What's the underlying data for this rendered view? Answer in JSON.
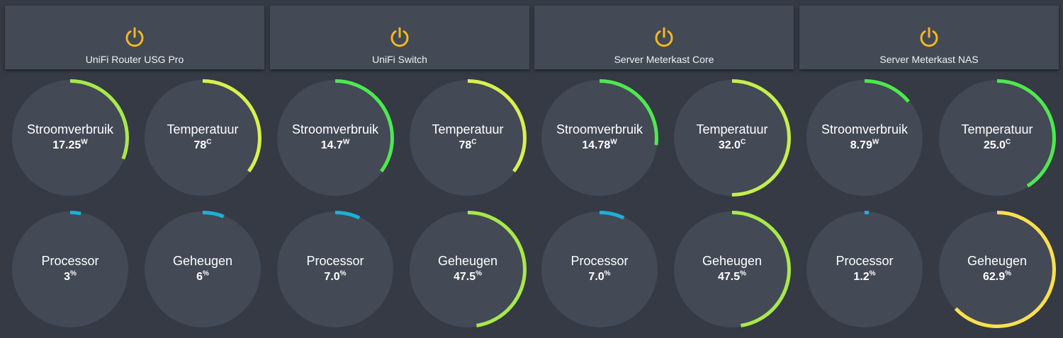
{
  "colors": {
    "background": "#353a44",
    "card": "#434955",
    "gauge_disc": "#434955",
    "power_icon": "#f5b723"
  },
  "devices": [
    {
      "name": "UniFi Router USG Pro",
      "icon": "power-icon",
      "gauges": [
        {
          "label": "Stroomverbruik",
          "value": "17.25",
          "unit": "W",
          "fill": 0.31,
          "color": "#a8e94b"
        },
        {
          "label": "Temperatuur",
          "value": "78",
          "unit": "C",
          "fill": 0.35,
          "color": "#d9f04f"
        },
        {
          "label": "Processor",
          "value": "3",
          "unit": "%",
          "fill": 0.03,
          "color": "#1bb1d6"
        },
        {
          "label": "Geheugen",
          "value": "6",
          "unit": "%",
          "fill": 0.06,
          "color": "#1bb1d6"
        }
      ]
    },
    {
      "name": "UniFi Switch",
      "icon": "power-icon",
      "gauges": [
        {
          "label": "Stroomverbruik",
          "value": "14.7",
          "unit": "W",
          "fill": 0.35,
          "color": "#4de94f"
        },
        {
          "label": "Temperatuur",
          "value": "78",
          "unit": "C",
          "fill": 0.35,
          "color": "#d9f04f"
        },
        {
          "label": "Processor",
          "value": "7.0",
          "unit": "%",
          "fill": 0.07,
          "color": "#1bb1d6"
        },
        {
          "label": "Geheugen",
          "value": "47.5",
          "unit": "%",
          "fill": 0.475,
          "color": "#a8e94b"
        }
      ]
    },
    {
      "name": "Server Meterkast Core",
      "icon": "power-icon",
      "gauges": [
        {
          "label": "Stroomverbruik",
          "value": "14.78",
          "unit": "W",
          "fill": 0.27,
          "color": "#4de94f"
        },
        {
          "label": "Temperatuur",
          "value": "32.0",
          "unit": "C",
          "fill": 0.5,
          "color": "#c4ef4c"
        },
        {
          "label": "Processor",
          "value": "7.0",
          "unit": "%",
          "fill": 0.07,
          "color": "#1bb1d6"
        },
        {
          "label": "Geheugen",
          "value": "47.5",
          "unit": "%",
          "fill": 0.475,
          "color": "#a8e94b"
        }
      ]
    },
    {
      "name": "Server Meterkast NAS",
      "icon": "power-icon",
      "gauges": [
        {
          "label": "Stroomverbruik",
          "value": "8.79",
          "unit": "W",
          "fill": 0.14,
          "color": "#4de94f"
        },
        {
          "label": "Temperatuur",
          "value": "25.0",
          "unit": "C",
          "fill": 0.41,
          "color": "#4de94f"
        },
        {
          "label": "Processor",
          "value": "1.2",
          "unit": "%",
          "fill": 0.012,
          "color": "#1bb1d6"
        },
        {
          "label": "Geheugen",
          "value": "62.9",
          "unit": "%",
          "fill": 0.629,
          "color": "#ffe04f"
        }
      ]
    }
  ]
}
